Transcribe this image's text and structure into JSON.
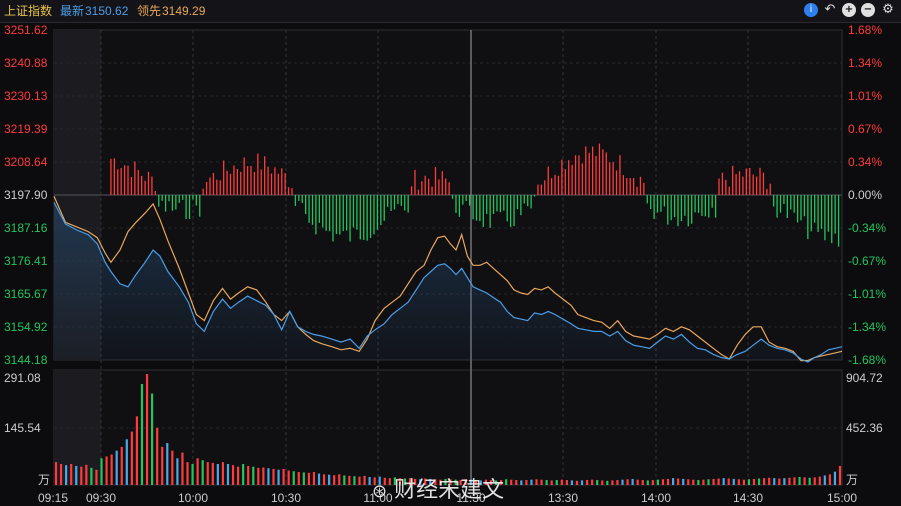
{
  "header": {
    "index_name": "上证指数",
    "latest_label": "最新",
    "latest_value": "3150.62",
    "leading_label": "领先",
    "leading_value": "3149.29",
    "icons": [
      "info-icon",
      "undo-icon",
      "zoom-in-icon",
      "zoom-out-icon",
      "settings-icon"
    ]
  },
  "colors": {
    "up": "#ff3b3b",
    "down": "#22c55e",
    "price_line": "#4a9ee8",
    "leading_line": "#e8a75c",
    "flat": "#cccccc"
  },
  "price_axis_left": [
    "3251.62",
    "3240.88",
    "3230.13",
    "3219.39",
    "3208.64",
    "3197.90",
    "3187.16",
    "3176.41",
    "3165.67",
    "3154.92",
    "3144.18"
  ],
  "price_axis_right": [
    "1.68%",
    "1.34%",
    "1.01%",
    "0.67%",
    "0.34%",
    "0.00%",
    "-0.34%",
    "-0.67%",
    "-1.01%",
    "-1.34%",
    "-1.68%"
  ],
  "volume_axis_left": [
    "291.08",
    "145.54",
    "万"
  ],
  "volume_axis_right": [
    "904.72",
    "452.36",
    "万"
  ],
  "time_axis": [
    "09:15",
    "09:30",
    "10:00",
    "10:30",
    "11:00",
    "11:30",
    "13:30",
    "14:00",
    "14:30",
    "15:00"
  ],
  "watermark": "财经宋建文",
  "chart_data": {
    "type": "line",
    "title": "上证指数",
    "x_range": [
      "09:15",
      "15:00"
    ],
    "ylim": [
      3144.18,
      3251.62
    ],
    "reference": 3197.9,
    "series": [
      {
        "name": "最新",
        "color": "#4a9ee8",
        "points": [
          [
            0,
            3195.5
          ],
          [
            10,
            3188.5
          ],
          [
            20,
            3186.5
          ],
          [
            30,
            3185
          ],
          [
            38,
            3182
          ],
          [
            45,
            3176
          ],
          [
            50,
            3173
          ],
          [
            58,
            3169
          ],
          [
            65,
            3168
          ],
          [
            72,
            3172
          ],
          [
            80,
            3176
          ],
          [
            87,
            3180
          ],
          [
            93,
            3178
          ],
          [
            100,
            3173
          ],
          [
            110,
            3168
          ],
          [
            118,
            3163
          ],
          [
            125,
            3156
          ],
          [
            132,
            3153.5
          ],
          [
            140,
            3160
          ],
          [
            148,
            3164
          ],
          [
            155,
            3161
          ],
          [
            162,
            3163
          ],
          [
            170,
            3165
          ],
          [
            178,
            3163.5
          ],
          [
            186,
            3162
          ],
          [
            193,
            3159
          ],
          [
            200,
            3154
          ],
          [
            207,
            3160
          ],
          [
            214,
            3155
          ],
          [
            221,
            3153.5
          ],
          [
            228,
            3152.5
          ],
          [
            235,
            3152
          ],
          [
            244,
            3151
          ],
          [
            252,
            3150
          ],
          [
            260,
            3151
          ],
          [
            268,
            3148
          ],
          [
            275,
            3152
          ],
          [
            282,
            3154
          ],
          [
            290,
            3156
          ],
          [
            297,
            3159
          ],
          [
            304,
            3161
          ],
          [
            311,
            3163
          ],
          [
            318,
            3167
          ],
          [
            325,
            3171
          ],
          [
            331,
            3173
          ],
          [
            337,
            3175
          ],
          [
            343,
            3175.5
          ],
          [
            348,
            3174
          ],
          [
            353,
            3172
          ],
          [
            358,
            3174
          ],
          [
            363,
            3171
          ],
          [
            368,
            3168
          ],
          [
            374,
            3167
          ],
          [
            380,
            3166
          ],
          [
            386,
            3164.5
          ],
          [
            392,
            3163
          ],
          [
            398,
            3160
          ],
          [
            404,
            3158
          ],
          [
            410,
            3157.5
          ],
          [
            416,
            3157
          ],
          [
            422,
            3159.5
          ],
          [
            428,
            3159
          ],
          [
            434,
            3160
          ],
          [
            440,
            3159
          ],
          [
            447,
            3157.5
          ],
          [
            454,
            3156
          ],
          [
            460,
            3154.5
          ],
          [
            467,
            3154
          ],
          [
            474,
            3153.5
          ],
          [
            481,
            3153.5
          ],
          [
            488,
            3152
          ],
          [
            495,
            3153.5
          ],
          [
            502,
            3150.5
          ],
          [
            509,
            3149
          ],
          [
            516,
            3148.5
          ],
          [
            523,
            3148
          ],
          [
            530,
            3150
          ],
          [
            537,
            3152
          ],
          [
            544,
            3151
          ],
          [
            551,
            3152.5
          ],
          [
            558,
            3150
          ],
          [
            565,
            3148
          ],
          [
            572,
            3147.5
          ],
          [
            579,
            3146
          ],
          [
            586,
            3145
          ],
          [
            593,
            3144.5
          ],
          [
            600,
            3146
          ],
          [
            607,
            3147
          ],
          [
            614,
            3149
          ],
          [
            621,
            3151
          ],
          [
            628,
            3149
          ],
          [
            635,
            3148
          ],
          [
            642,
            3147.5
          ],
          [
            649,
            3146.5
          ],
          [
            656,
            3144.5
          ],
          [
            662,
            3143.5
          ],
          [
            668,
            3145
          ],
          [
            674,
            3146
          ],
          [
            680,
            3147.5
          ],
          [
            686,
            3148
          ],
          [
            692,
            3148.5
          ]
        ]
      },
      {
        "name": "领先",
        "color": "#e8a75c",
        "points": [
          [
            0,
            3197.5
          ],
          [
            10,
            3189
          ],
          [
            20,
            3187.5
          ],
          [
            30,
            3186
          ],
          [
            38,
            3184
          ],
          [
            45,
            3179
          ],
          [
            50,
            3176
          ],
          [
            58,
            3180
          ],
          [
            65,
            3186
          ],
          [
            72,
            3189
          ],
          [
            80,
            3192
          ],
          [
            87,
            3195
          ],
          [
            93,
            3190
          ],
          [
            100,
            3183
          ],
          [
            110,
            3174
          ],
          [
            118,
            3166
          ],
          [
            125,
            3159
          ],
          [
            132,
            3157
          ],
          [
            140,
            3163.5
          ],
          [
            148,
            3167.5
          ],
          [
            155,
            3164
          ],
          [
            162,
            3166
          ],
          [
            170,
            3168
          ],
          [
            178,
            3167
          ],
          [
            186,
            3163
          ],
          [
            193,
            3159
          ],
          [
            200,
            3157
          ],
          [
            207,
            3160
          ],
          [
            214,
            3155
          ],
          [
            221,
            3152.5
          ],
          [
            228,
            3150.5
          ],
          [
            235,
            3149.5
          ],
          [
            244,
            3148.5
          ],
          [
            252,
            3147.5
          ],
          [
            260,
            3148
          ],
          [
            268,
            3147
          ],
          [
            275,
            3151
          ],
          [
            282,
            3157
          ],
          [
            290,
            3161
          ],
          [
            297,
            3163
          ],
          [
            304,
            3165
          ],
          [
            311,
            3169
          ],
          [
            318,
            3173
          ],
          [
            325,
            3175
          ],
          [
            331,
            3180
          ],
          [
            337,
            3184
          ],
          [
            343,
            3184.5
          ],
          [
            348,
            3182
          ],
          [
            353,
            3180
          ],
          [
            358,
            3185
          ],
          [
            363,
            3178
          ],
          [
            368,
            3175
          ],
          [
            374,
            3175
          ],
          [
            380,
            3176
          ],
          [
            386,
            3174
          ],
          [
            392,
            3172
          ],
          [
            398,
            3170
          ],
          [
            404,
            3167
          ],
          [
            410,
            3166
          ],
          [
            416,
            3165.5
          ],
          [
            422,
            3167.5
          ],
          [
            428,
            3167
          ],
          [
            434,
            3168
          ],
          [
            440,
            3166
          ],
          [
            447,
            3164
          ],
          [
            454,
            3162
          ],
          [
            460,
            3159
          ],
          [
            467,
            3158
          ],
          [
            474,
            3157
          ],
          [
            481,
            3156.5
          ],
          [
            488,
            3154.5
          ],
          [
            495,
            3157
          ],
          [
            502,
            3153.5
          ],
          [
            509,
            3152
          ],
          [
            516,
            3151.5
          ],
          [
            523,
            3151
          ],
          [
            530,
            3152.5
          ],
          [
            537,
            3154.5
          ],
          [
            544,
            3153.5
          ],
          [
            551,
            3155
          ],
          [
            558,
            3154
          ],
          [
            565,
            3152
          ],
          [
            572,
            3150
          ],
          [
            579,
            3148
          ],
          [
            586,
            3146
          ],
          [
            593,
            3144.5
          ],
          [
            600,
            3149
          ],
          [
            607,
            3152.5
          ],
          [
            614,
            3155
          ],
          [
            621,
            3155
          ],
          [
            628,
            3150
          ],
          [
            635,
            3148.5
          ],
          [
            642,
            3148
          ],
          [
            649,
            3147
          ],
          [
            656,
            3144
          ],
          [
            662,
            3144
          ],
          [
            668,
            3145
          ],
          [
            674,
            3145.5
          ],
          [
            680,
            3146
          ],
          [
            686,
            3146.5
          ],
          [
            692,
            3147
          ]
        ]
      }
    ],
    "volume": {
      "name": "成交量 (万)",
      "ylim": [
        0,
        291.08
      ],
      "values": [
        60,
        55,
        52,
        55,
        50,
        48,
        53,
        45,
        40,
        70,
        75,
        80,
        90,
        100,
        120,
        140,
        180,
        265,
        291,
        240,
        150,
        100,
        110,
        90,
        70,
        85,
        60,
        55,
        70,
        65,
        60,
        58,
        55,
        60,
        55,
        52,
        48,
        55,
        50,
        48,
        45,
        46,
        44,
        42,
        40,
        42,
        38,
        36,
        34,
        33,
        32,
        34,
        30,
        28,
        27,
        26,
        28,
        25,
        24,
        23,
        22,
        24,
        21,
        20,
        22,
        19,
        18,
        20,
        18,
        17,
        18,
        16,
        15,
        17,
        16,
        15,
        14,
        16,
        15,
        14,
        13,
        15,
        14,
        13,
        12,
        14,
        13,
        12,
        13,
        15,
        14,
        13,
        12,
        13,
        14,
        15,
        14,
        13,
        12,
        13,
        14,
        13,
        12,
        11,
        12,
        13,
        14,
        13,
        12,
        11,
        12,
        13,
        14,
        15,
        16,
        14,
        13,
        12,
        13,
        14,
        15,
        16,
        18,
        17,
        16,
        15,
        14,
        13,
        14,
        15,
        16,
        17,
        18,
        17,
        16,
        15,
        14,
        15,
        16,
        17,
        18,
        19,
        18,
        17,
        18,
        19,
        20,
        21,
        20,
        19,
        20,
        22,
        25,
        28,
        35,
        50
      ]
    }
  }
}
